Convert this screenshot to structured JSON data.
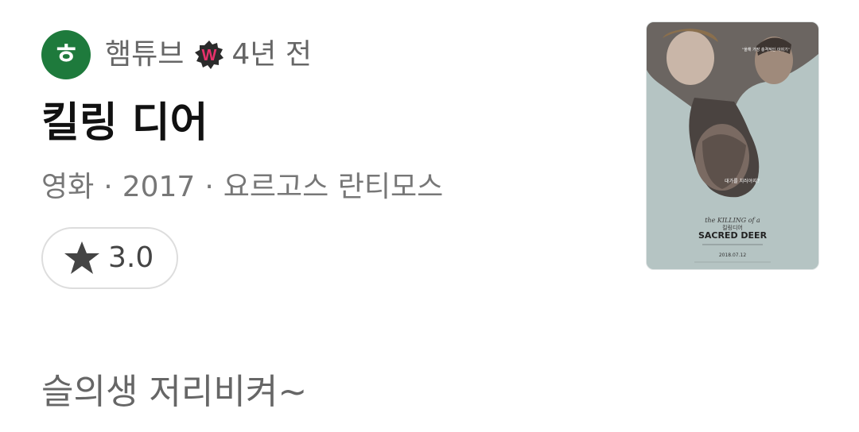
{
  "author": {
    "avatar_initial": "ㅎ",
    "name": "햄튜브",
    "badge_letter": "W",
    "time_ago": "4년 전"
  },
  "content": {
    "title": "킬링 디어",
    "category": "영화",
    "year": "2017",
    "director": "요르고스 란티모스",
    "separator": "·"
  },
  "rating": {
    "value": "3.0",
    "icon": "star-icon"
  },
  "comment": {
    "text": "슬의생 저리비켜~"
  },
  "poster": {
    "title_small": "the KILLING of a",
    "title_korean": "킬링디어",
    "title_large": "SACRED DEER",
    "tagline": "대가를 치러야지?",
    "date": "2018.07.12",
    "quote": "\"올해 가장 충격적인 이야기\""
  },
  "colors": {
    "avatar_bg": "#1e7a3c",
    "badge_bg": "#2b2b2b",
    "badge_letter": "#e8316b",
    "poster_bg": "#b5c4c3"
  }
}
